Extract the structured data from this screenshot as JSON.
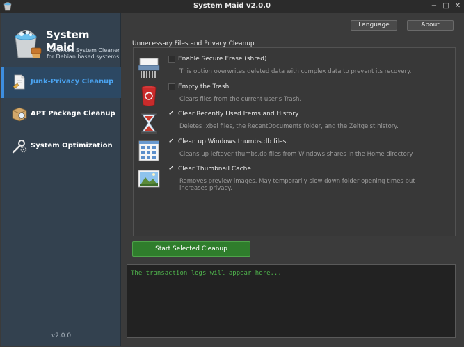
{
  "window": {
    "title": "System Maid v2.0.0",
    "controls": {
      "minimize": "−",
      "maximize": "□",
      "close": "✕"
    }
  },
  "sidebar": {
    "brand": {
      "name": "System Maid",
      "tagline_1": "Advanced System Cleaner",
      "tagline_2": "for Debian based systems",
      "icon": "bucket-brush-icon"
    },
    "items": [
      {
        "label": "Junk-Privacy Cleanup",
        "icon": "document-broom-icon",
        "active": true
      },
      {
        "label": "APT Package Cleanup",
        "icon": "package-search-icon",
        "active": false
      },
      {
        "label": "System Optimization",
        "icon": "wrench-gears-icon",
        "active": false
      }
    ],
    "version": "v2.0.0"
  },
  "header": {
    "language_label": "Language",
    "about_label": "About"
  },
  "main": {
    "group_title": "Unnecessary Files and Privacy Cleanup",
    "options": [
      {
        "label": "Enable Secure Erase (shred)",
        "description": "This option overwrites deleted data with complex data to prevent its recovery.",
        "checked": false,
        "icon": "shredder-icon"
      },
      {
        "label": "Empty the Trash",
        "description": "Clears files from the current user's Trash.",
        "checked": false,
        "icon": "trash-icon"
      },
      {
        "label": "Clear Recently Used Items and History",
        "description": "Deletes .xbel files, the RecentDocuments folder, and the Zeitgeist history.",
        "checked": true,
        "icon": "hourglass-icon"
      },
      {
        "label": "Clean up Windows thumbs.db files.",
        "description": "Cleans up leftover thumbs.db files from Windows shares in the Home directory.",
        "checked": true,
        "icon": "thumbnail-grid-icon"
      },
      {
        "label": "Clear Thumbnail Cache",
        "description": "Removes preview images. May temporarily slow down folder opening times but increases privacy.",
        "checked": true,
        "icon": "image-icon"
      }
    ],
    "run_label": "Start Selected Cleanup",
    "log_placeholder": "The transaction logs will appear here...",
    "check_mark": "✓"
  },
  "colors": {
    "sidebar_bg": "#33414f",
    "active_accent": "#3d8ee0",
    "run_button": "#2f7d2c",
    "log_text": "#4fb34c"
  }
}
